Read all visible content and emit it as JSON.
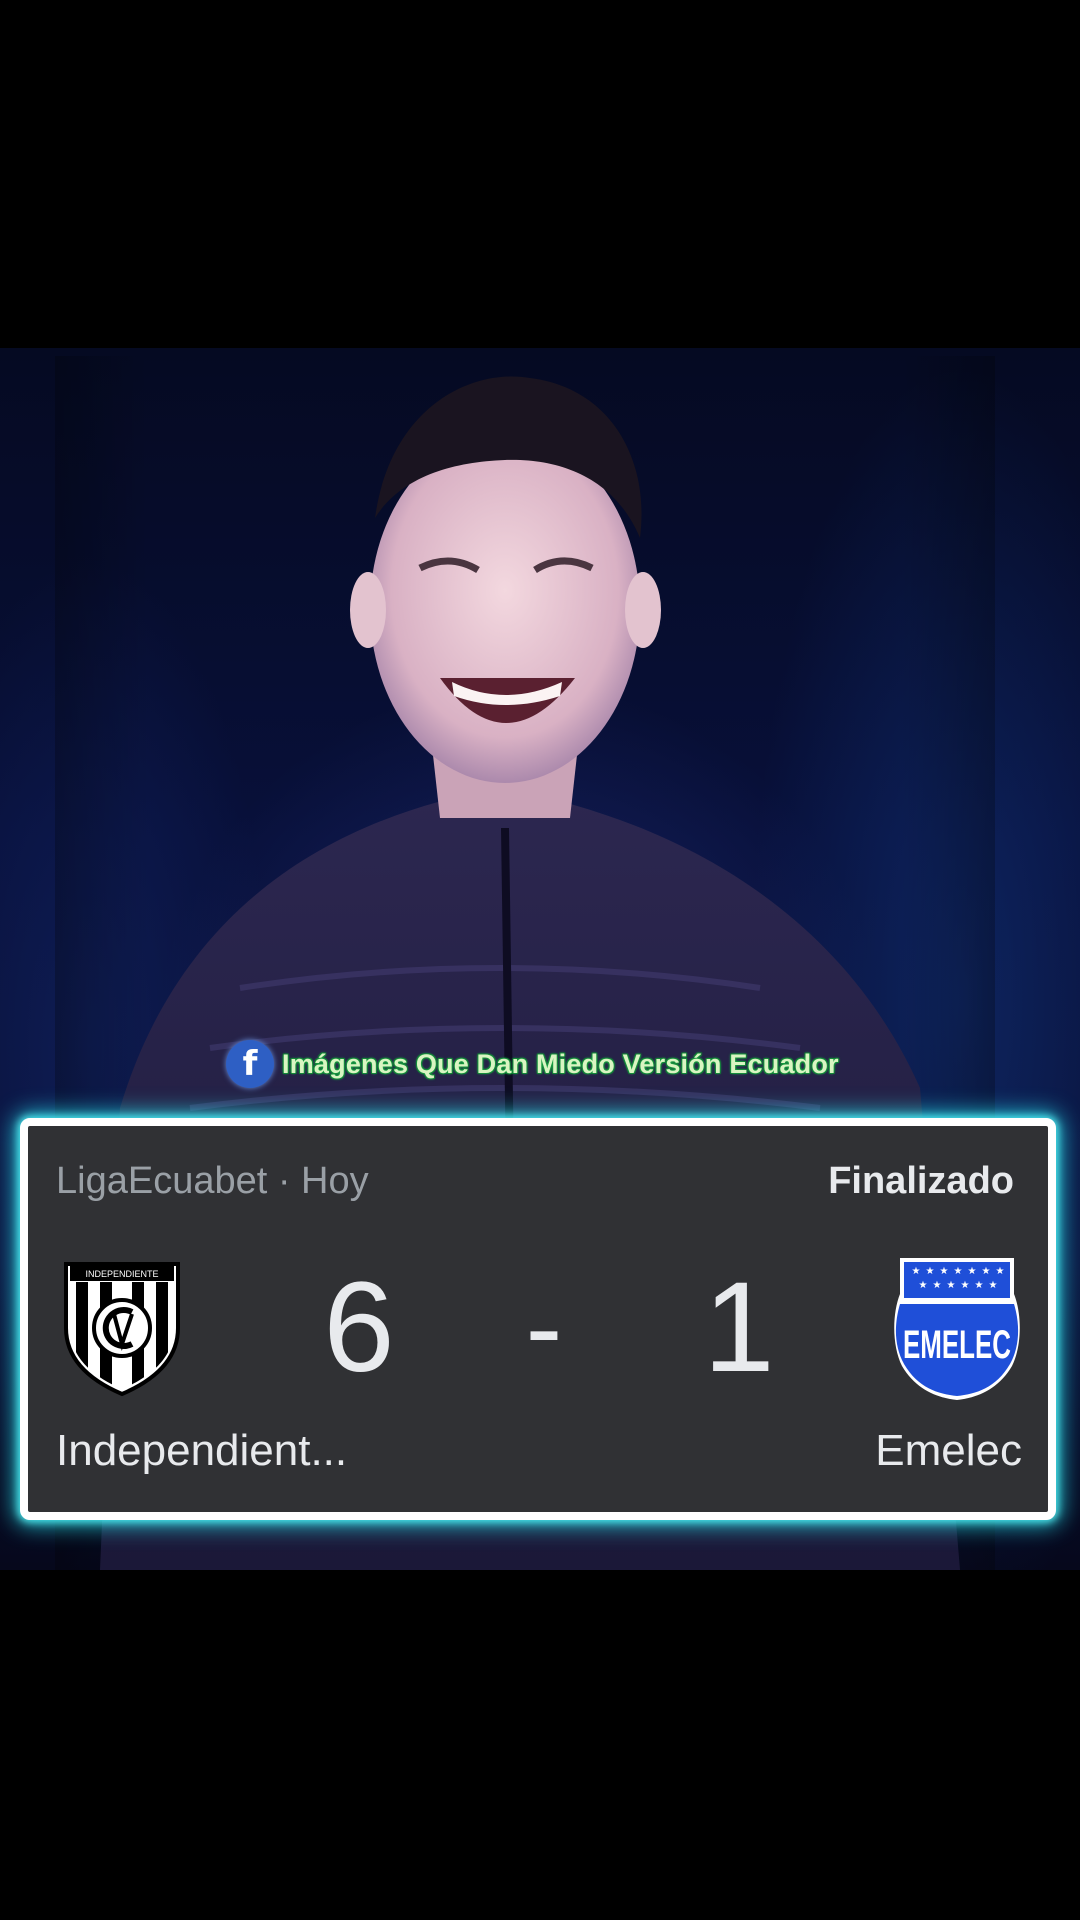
{
  "watermark": {
    "icon": "facebook-icon",
    "text": "Imágenes Que Dan Miedo Versión Ecuador"
  },
  "scorecard": {
    "league": "LigaEcuabet · Hoy",
    "status": "Finalizado",
    "home": {
      "name": "Independient...",
      "score": "6",
      "crest": "independiente-crest-icon"
    },
    "separator": "-",
    "away": {
      "name": "Emelec",
      "score": "1",
      "crest": "emelec-crest-icon",
      "crest_text": "EMELEC"
    },
    "colors": {
      "card_bg": "#303134",
      "glow": "#28e6f0",
      "emelec_blue": "#1f4fd8"
    }
  }
}
